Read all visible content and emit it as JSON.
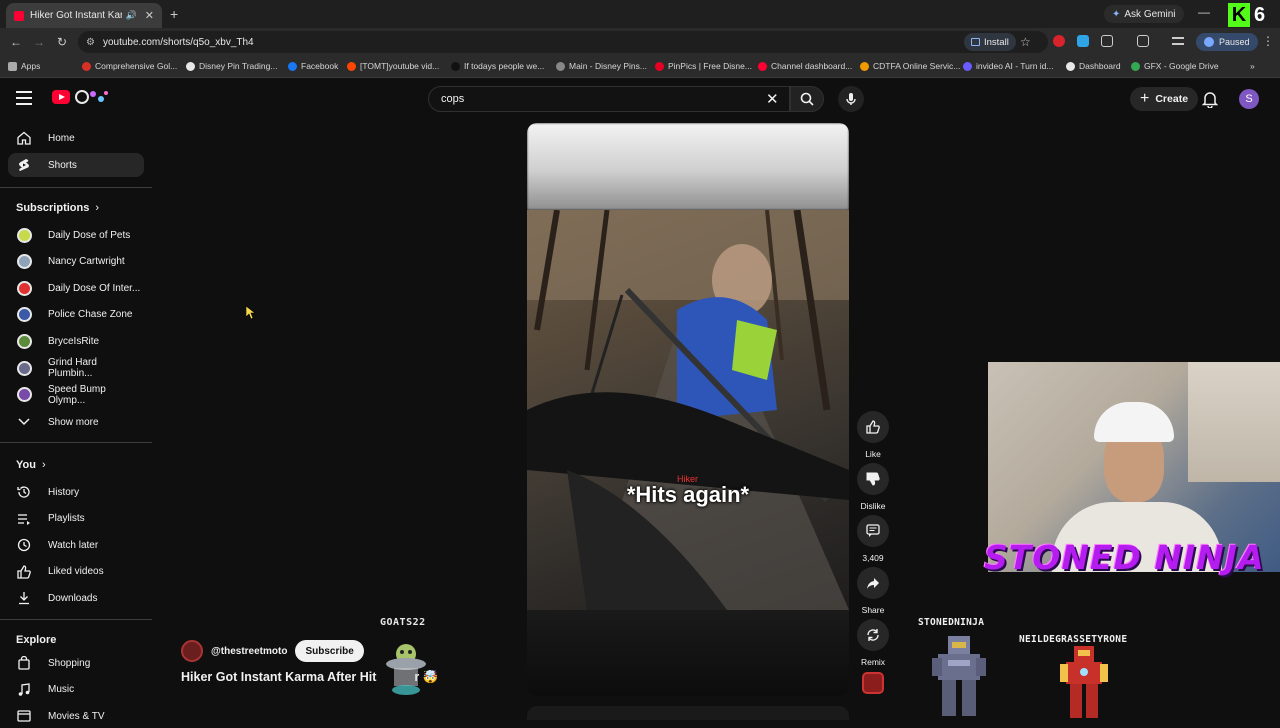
{
  "browser": {
    "tab_title": "Hiker Got Instant Karma Af",
    "url": "youtube.com/shorts/q5o_xbv_Th4",
    "ask_gemini": "Ask Gemini",
    "install_label": "Install",
    "profile_status": "Paused",
    "stream_viewers": "6",
    "bookmarks": [
      "Apps",
      "Comprehensive Gol...",
      "Disney Pin Trading...",
      "Facebook",
      "[TOMT]youtube vid...",
      "If todays people we...",
      "Main - Disney Pins...",
      "PinPics | Free Disne...",
      "Channel dashboard...",
      "CDTFA Online Servic...",
      "invideo AI - Turn id...",
      "Dashboard",
      "GFX - Google Drive"
    ]
  },
  "header": {
    "search_value": "cops",
    "create_label": "Create",
    "user_initial": "S"
  },
  "sidebar": {
    "main": [
      {
        "label": "Home",
        "icon": "home-icon"
      },
      {
        "label": "Shorts",
        "icon": "shorts-icon"
      }
    ],
    "subscriptions_heading": "Subscriptions",
    "subscriptions": [
      {
        "label": "Daily Dose of Pets",
        "color": "#c8d94a"
      },
      {
        "label": "Nancy Cartwright",
        "color": "#8fa3b8"
      },
      {
        "label": "Daily Dose Of Inter...",
        "color": "#e03030"
      },
      {
        "label": "Police Chase Zone",
        "color": "#3a5aa8"
      },
      {
        "label": "BryceIsRite",
        "color": "#5a8a3a"
      },
      {
        "label": "Grind Hard Plumbin...",
        "color": "#6a6a8a"
      },
      {
        "label": "Speed Bump Olymp...",
        "color": "#7a4aa8"
      }
    ],
    "show_more": "Show more",
    "you_heading": "You",
    "you_items": [
      {
        "label": "History",
        "icon": "history-icon"
      },
      {
        "label": "Playlists",
        "icon": "playlists-icon"
      },
      {
        "label": "Watch later",
        "icon": "watch-later-icon"
      },
      {
        "label": "Liked videos",
        "icon": "thumbs-up-icon"
      },
      {
        "label": "Downloads",
        "icon": "download-icon"
      }
    ],
    "explore_heading": "Explore",
    "explore_items": [
      {
        "label": "Shopping",
        "icon": "shopping-bag-icon"
      },
      {
        "label": "Music",
        "icon": "music-icon"
      },
      {
        "label": "Movies & TV",
        "icon": "film-icon"
      }
    ]
  },
  "short": {
    "caption": "*Hits again*",
    "caption_tag": "Hiker",
    "channel": "@thestreetmoto",
    "subscribe_label": "Subscribe",
    "title": "Hiker Got Instant Karma After Hit",
    "title_tail": "r 🤯",
    "actions": {
      "like": "Like",
      "dislike": "Dislike",
      "comments": "3,409",
      "share": "Share",
      "remix": "Remix"
    }
  },
  "overlay": {
    "streamer_banner": "STONED NINJA",
    "chat_users": [
      "GOATS22",
      "STONEDNINJA",
      "NEILDEGRASSETYRONE"
    ]
  }
}
